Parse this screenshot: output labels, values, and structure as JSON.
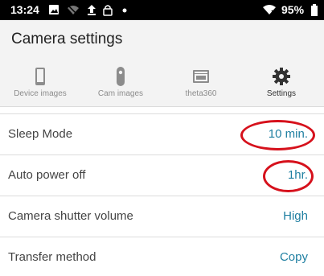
{
  "status_bar": {
    "time": "13:24",
    "battery": "95%",
    "icons": [
      "image-icon",
      "wifi-off-icon",
      "upload-icon",
      "lock-icon",
      "dot-icon",
      "wifi-icon",
      "battery-icon"
    ]
  },
  "header": {
    "title": "Camera settings"
  },
  "tabs": [
    {
      "label": "Device images",
      "icon": "phone-icon",
      "active": false
    },
    {
      "label": "Cam images",
      "icon": "camera-device-icon",
      "active": false
    },
    {
      "label": "theta360",
      "icon": "panorama-icon",
      "active": false
    },
    {
      "label": "Settings",
      "icon": "gear-icon",
      "active": true
    }
  ],
  "settings": [
    {
      "label": "Sleep Mode",
      "value": "10 min.",
      "highlighted": true
    },
    {
      "label": "Auto power off",
      "value": "1hr.",
      "highlighted": true
    },
    {
      "label": "Camera shutter volume",
      "value": "High",
      "highlighted": false
    },
    {
      "label": "Transfer method",
      "value": "Copy",
      "highlighted": false
    }
  ],
  "colors": {
    "accent": "#1f7fa1",
    "highlight": "#d6111c",
    "header_bg": "#f3f3f3",
    "status_bar_bg": "#000000"
  }
}
